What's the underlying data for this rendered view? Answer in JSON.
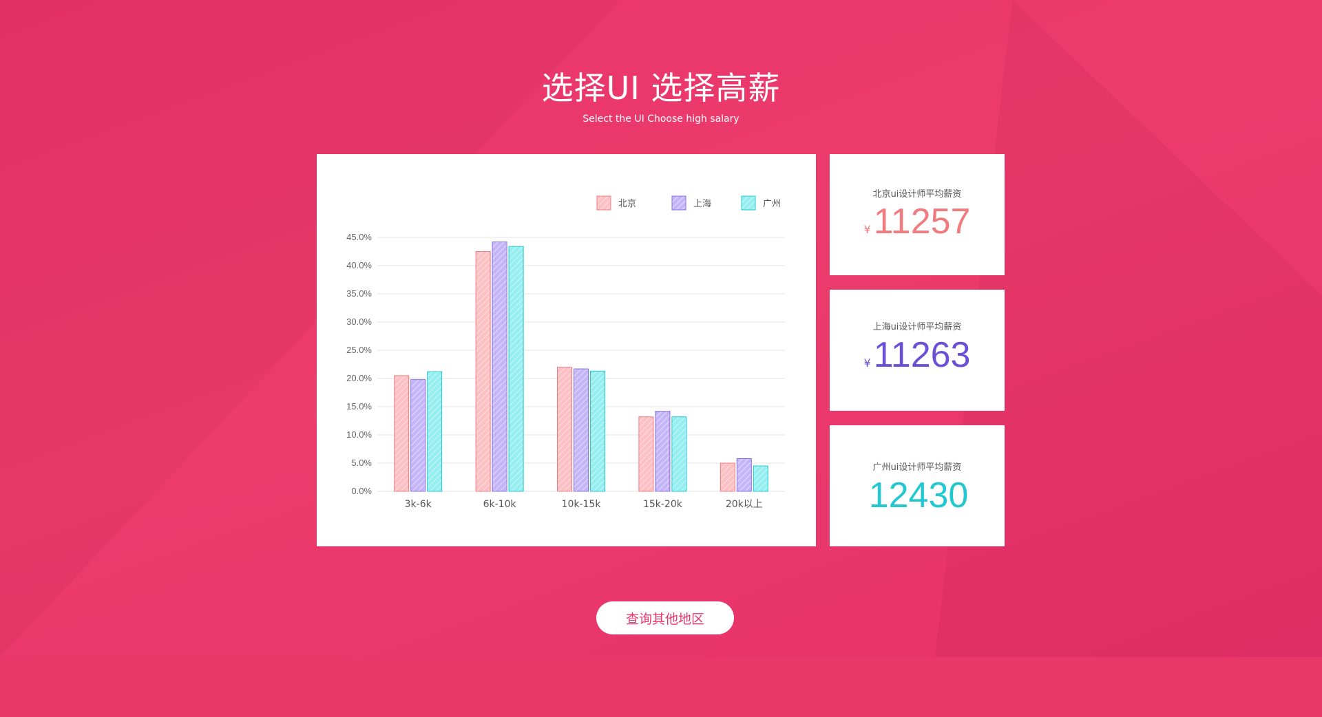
{
  "header": {
    "title": "选择UI  选择高薪",
    "subtitle": "Select the UI Choose high salary"
  },
  "colors": {
    "background": "#ea3a6b",
    "beijing": "#f07b7e",
    "shanghai": "#6b4fd6",
    "guangzhou": "#22c8cf",
    "button_text": "#e8376c"
  },
  "chart_data": {
    "type": "bar",
    "categories": [
      "3k-6k",
      "6k-10k",
      "10k-15k",
      "15k-20k",
      "20k以上"
    ],
    "series": [
      {
        "name": "北京",
        "values": [
          20.5,
          42.5,
          22.0,
          13.2,
          5.0
        ],
        "color": "#f07b7e",
        "fill": "#ffc0c3"
      },
      {
        "name": "上海",
        "values": [
          19.8,
          44.2,
          21.7,
          14.2,
          5.8
        ],
        "color": "#8a6fe6",
        "fill": "#c4b5fb"
      },
      {
        "name": "广州",
        "values": [
          21.2,
          43.4,
          21.3,
          13.2,
          4.5
        ],
        "color": "#22c8cf",
        "fill": "#95eef0"
      }
    ],
    "y_ticks": [
      "0.0%",
      "5.0%",
      "10.0%",
      "15.0%",
      "20.0%",
      "25.0%",
      "30.0%",
      "35.0%",
      "40.0%",
      "45.0%"
    ],
    "ylim": [
      0,
      45
    ],
    "legend_position": "top-right",
    "grid": true
  },
  "stats": [
    {
      "label": "北京ui设计师平均薪资",
      "currency": "¥",
      "value": "11257",
      "color": "#f07b7e"
    },
    {
      "label": "上海ui设计师平均薪资",
      "currency": "¥",
      "value": "11263",
      "color": "#6b4fd6"
    },
    {
      "label": "广州ui设计师平均薪资",
      "currency": "",
      "value": "12430",
      "color": "#22c8cf"
    }
  ],
  "query_button": {
    "label": "查询其他地区"
  }
}
